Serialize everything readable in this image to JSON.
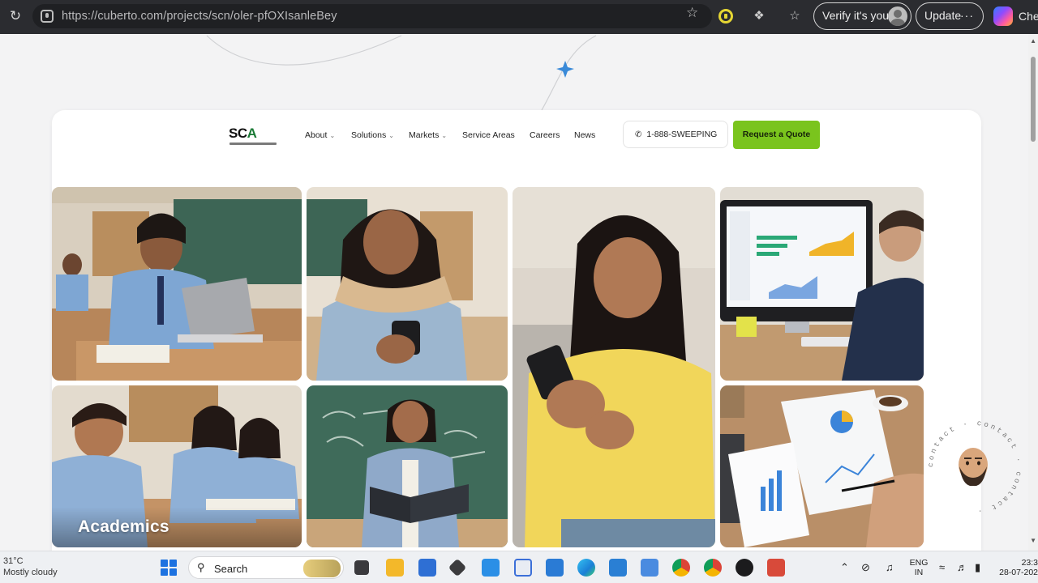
{
  "browser": {
    "url": "https://cuberto.com/projects/scn/oler-pfOXIsanleBey",
    "verify_label": "Verify it's you",
    "update_label": "Update",
    "update_more": "···",
    "side_label": "Che"
  },
  "site": {
    "logo": {
      "text_main": "SC",
      "text_accent": "A"
    },
    "nav": [
      {
        "label": "About",
        "dropdown": true
      },
      {
        "label": "Solutions",
        "dropdown": true
      },
      {
        "label": "Markets",
        "dropdown": true
      },
      {
        "label": "Service Areas",
        "dropdown": false
      },
      {
        "label": "Careers",
        "dropdown": false
      },
      {
        "label": "News",
        "dropdown": false
      }
    ],
    "phone": "1-888-SWEEPING",
    "cta": "Request a Quote",
    "accent_color": "#7ac41d",
    "tiles": [
      {
        "caption": ""
      },
      {
        "caption": ""
      },
      {
        "caption": ""
      },
      {
        "caption": ""
      },
      {
        "caption": "Academics"
      },
      {
        "caption": ""
      },
      {
        "caption": ""
      }
    ],
    "contact_ring": "contact · contact · contact ·"
  },
  "taskbar": {
    "weather_temp": "31°C",
    "weather_desc": "Mostly cloudy",
    "search_label": "Search",
    "lang_top": "ENG",
    "lang_bottom": "IN",
    "time": "23:3",
    "date": "28-07-202"
  }
}
